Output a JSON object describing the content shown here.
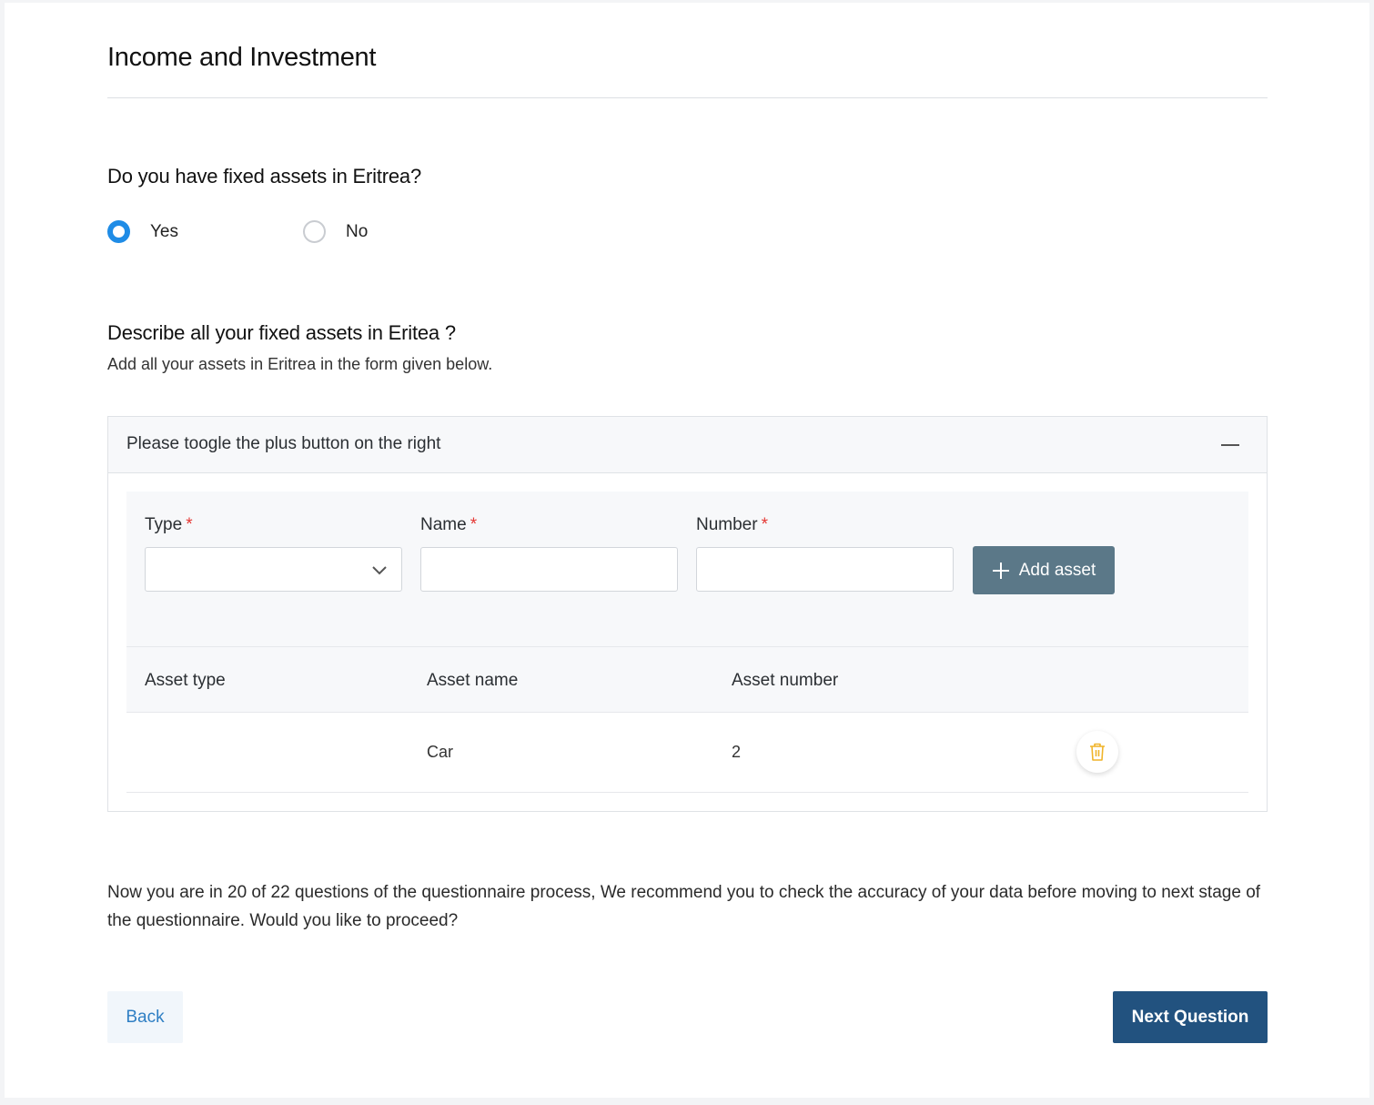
{
  "page": {
    "title": "Income and Investment"
  },
  "question1": {
    "text": "Do you have fixed assets in Eritrea?",
    "options": [
      {
        "label": "Yes",
        "selected": true
      },
      {
        "label": "No",
        "selected": false
      }
    ]
  },
  "question2": {
    "text": "Describe all your fixed assets in Eritea ?",
    "subtext": "Add all your assets in Eritrea in the form given below."
  },
  "panel": {
    "header": "Please toogle the plus button on the right",
    "collapse_icon": "minus-icon",
    "form": {
      "type_label": "Type",
      "name_label": "Name",
      "number_label": "Number",
      "required_mark": "*",
      "type_value": "",
      "name_value": "",
      "number_value": "",
      "add_button": "Add asset"
    },
    "table": {
      "columns": [
        "Asset type",
        "Asset name",
        "Asset number"
      ],
      "rows": [
        {
          "type": "",
          "name": "Car",
          "number": "2"
        }
      ]
    }
  },
  "info_text": "Now you are in 20 of 22 questions of the questionnaire process, We recommend you to check the accuracy of your data before moving to next stage of the questionnaire. Would you like to proceed?",
  "buttons": {
    "back": "Back",
    "next": "Next Question"
  },
  "colors": {
    "radio_checked": "#1f8ce6",
    "add_button_bg": "#5b7888",
    "next_button_bg": "#22527f",
    "back_button_text": "#2f7fc4",
    "delete_icon": "#f0b429",
    "required": "#e53935"
  }
}
